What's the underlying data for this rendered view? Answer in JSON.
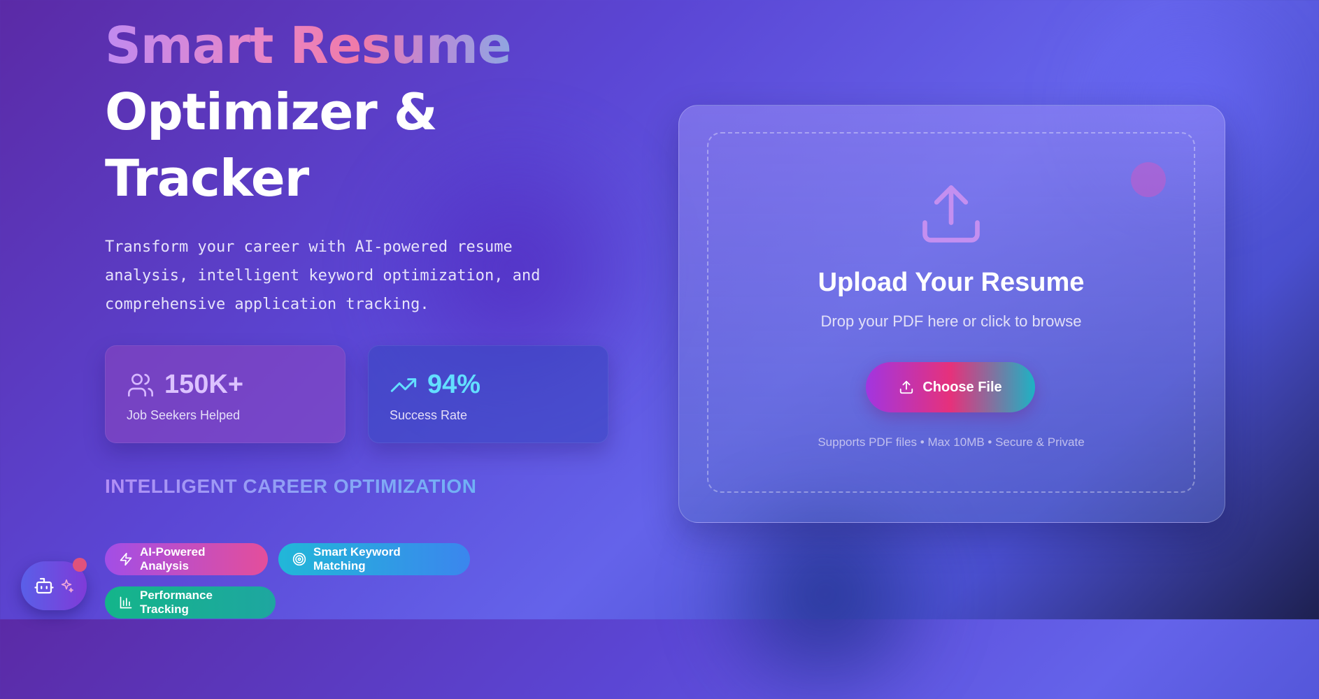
{
  "hero": {
    "title_line1": "Smart Resume",
    "title_line2": "Optimizer &",
    "title_line3": "Tracker",
    "description": "Transform your career with AI-powered resume analysis, intelligent keyword optimization, and comprehensive application tracking."
  },
  "stats": [
    {
      "value": "150K+",
      "label": "Job Seekers Helped",
      "icon": "users-icon"
    },
    {
      "value": "94%",
      "label": "Success Rate",
      "icon": "trending-up-icon"
    }
  ],
  "section_heading": "INTELLIGENT CAREER OPTIMIZATION",
  "features": [
    {
      "label": "AI-Powered Analysis",
      "icon": "zap-icon"
    },
    {
      "label": "Smart Keyword Matching",
      "icon": "target-icon"
    },
    {
      "label": "Performance Tracking",
      "icon": "bar-chart-icon"
    }
  ],
  "upload": {
    "title": "Upload Your Resume",
    "subtitle": "Drop your PDF here or click to browse",
    "button_label": "Choose File",
    "footnote": "Supports PDF files • Max 10MB • Secure & Private",
    "icon": "upload-icon"
  },
  "assistant": {
    "icon": "bot-icon",
    "badge_icon": "sparkles-icon"
  },
  "colors": {
    "accent_purple": "#a24ee6",
    "accent_pink": "#e6317b",
    "accent_cyan": "#1db3c4",
    "success_green": "#14b58a"
  }
}
